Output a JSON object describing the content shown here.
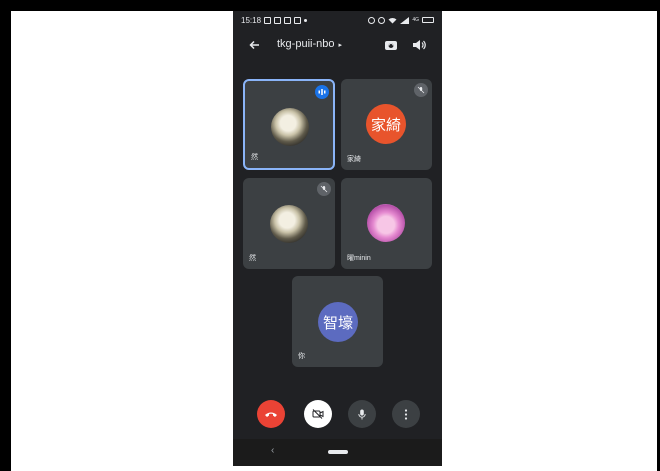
{
  "status_bar": {
    "time": "15:18",
    "signal_text": "4G"
  },
  "header": {
    "meeting_code": "tkg-puii-nbo",
    "caret": "▸"
  },
  "participants": [
    {
      "name": "然",
      "avatar": "photo",
      "speaking": true,
      "muted": false
    },
    {
      "name": "家綺",
      "avatar_text": "家綺",
      "muted": true
    },
    {
      "name": "然",
      "avatar": "photo",
      "muted": true
    },
    {
      "name": "曜minin",
      "avatar": "anime",
      "muted": false
    },
    {
      "name": "你",
      "avatar_text": "智壕",
      "muted": false
    }
  ],
  "colors": {
    "background": "#202124",
    "tile": "#3c4043",
    "active_border": "#8ab4f8",
    "end_call": "#ea4335",
    "orange_avatar": "#e8542c",
    "blue_avatar": "#5c6bc0"
  },
  "controls": [
    "end-call",
    "camera-off",
    "microphone",
    "more"
  ],
  "nav": {
    "back_glyph": "‹"
  }
}
